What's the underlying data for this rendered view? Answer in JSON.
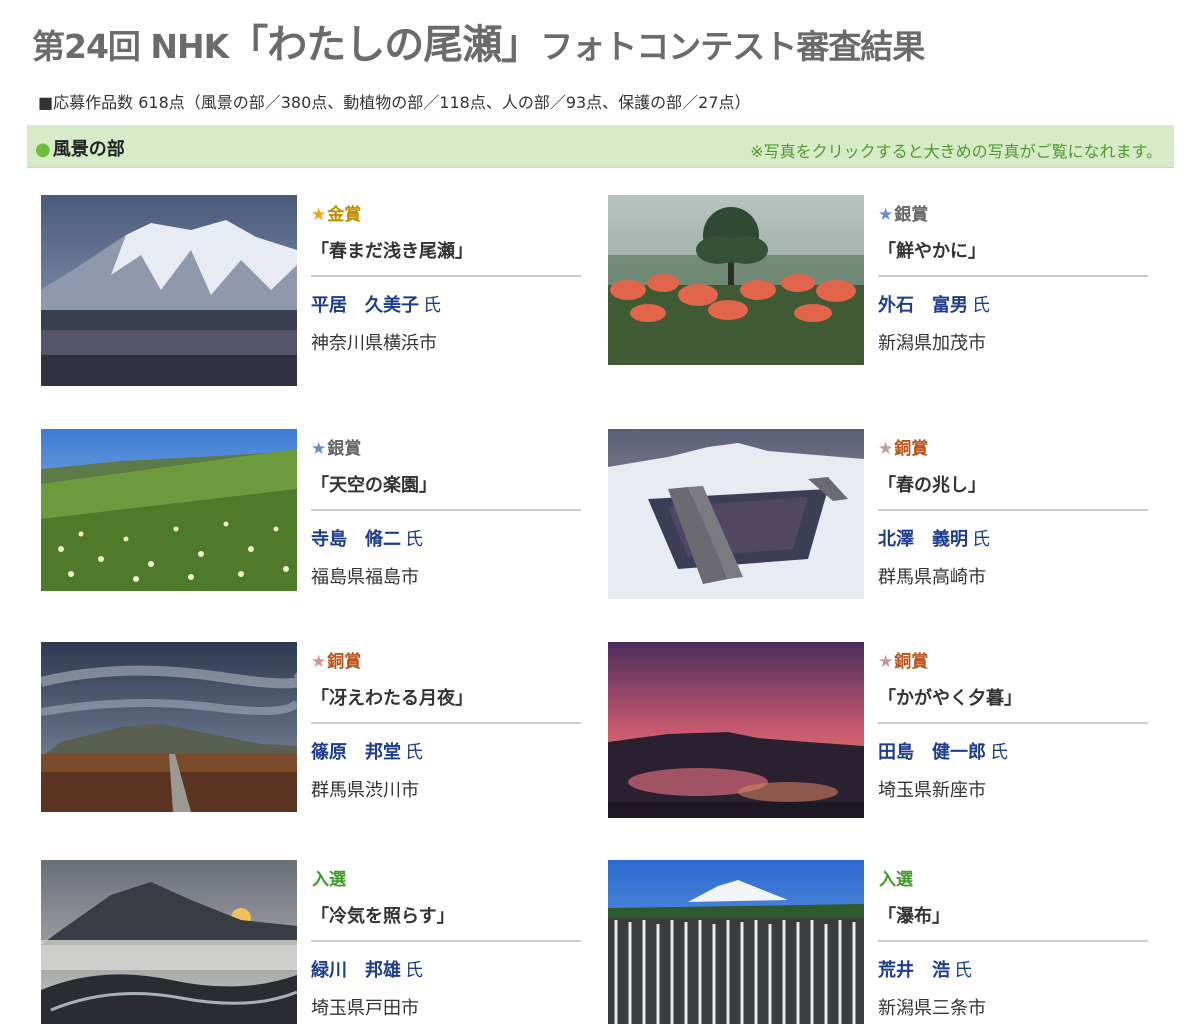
{
  "header": {
    "title_prefix": "第24回 NHK",
    "title_main": "「わたしの尾瀬」",
    "title_suffix": "フォトコンテスト審査結果",
    "summary": "■応募作品数 618点（風景の部／380点、動植物の部／118点、人の部／93点、保護の部／27点）"
  },
  "section": {
    "dot": "●",
    "title": "風景の部",
    "note": "※写真をクリックすると大きめの写真がご覧になれます。"
  },
  "colors": {
    "gold": "#c28b00",
    "silver": "#666666",
    "bronze": "#b8541a",
    "selected": "#3f9a2a",
    "star_gold": "#f0a020",
    "star_silver": "#6a8cc8",
    "star_bronze": "#c89898"
  },
  "entries": [
    {
      "star": "★",
      "award": "金賞",
      "title": "「春まだ浅き尾瀬」",
      "name": "平居　久美子",
      "honorific": "氏",
      "location": "神奈川県横浜市",
      "photo_icon": "snowy-mountain-photo"
    },
    {
      "star": "★",
      "award": "銀賞",
      "title": "「鮮やかに」",
      "name": "外石　富男",
      "honorific": "氏",
      "location": "新潟県加茂市",
      "photo_icon": "tree-flowers-photo"
    },
    {
      "star": "★",
      "award": "銀賞",
      "title": "「天空の楽園」",
      "name": "寺島　脩二",
      "honorific": "氏",
      "location": "福島県福島市",
      "photo_icon": "flower-meadow-photo"
    },
    {
      "star": "★",
      "award": "銅賞",
      "title": "「春の兆し」",
      "name": "北澤　義明",
      "honorific": "氏",
      "location": "群馬県高崎市",
      "photo_icon": "snow-boardwalk-photo"
    },
    {
      "star": "★",
      "award": "銅賞",
      "title": "「冴えわたる月夜」",
      "name": "篠原　邦堂",
      "honorific": "氏",
      "location": "群馬県渋川市",
      "photo_icon": "night-marsh-photo"
    },
    {
      "star": "★",
      "award": "銅賞",
      "title": "「かがやく夕暮」",
      "name": "田島　健一郎",
      "honorific": "氏",
      "location": "埼玉県新座市",
      "photo_icon": "sunset-pond-photo"
    },
    {
      "star": "",
      "award": "入選",
      "title": "「冷気を照らす」",
      "name": "緑川　邦雄",
      "honorific": "氏",
      "location": "埼玉県戸田市",
      "photo_icon": "misty-dawn-photo"
    },
    {
      "star": "",
      "award": "入選",
      "title": "「瀑布」",
      "name": "荒井　浩",
      "honorific": "氏",
      "location": "新潟県三条市",
      "photo_icon": "frost-forest-photo"
    }
  ]
}
